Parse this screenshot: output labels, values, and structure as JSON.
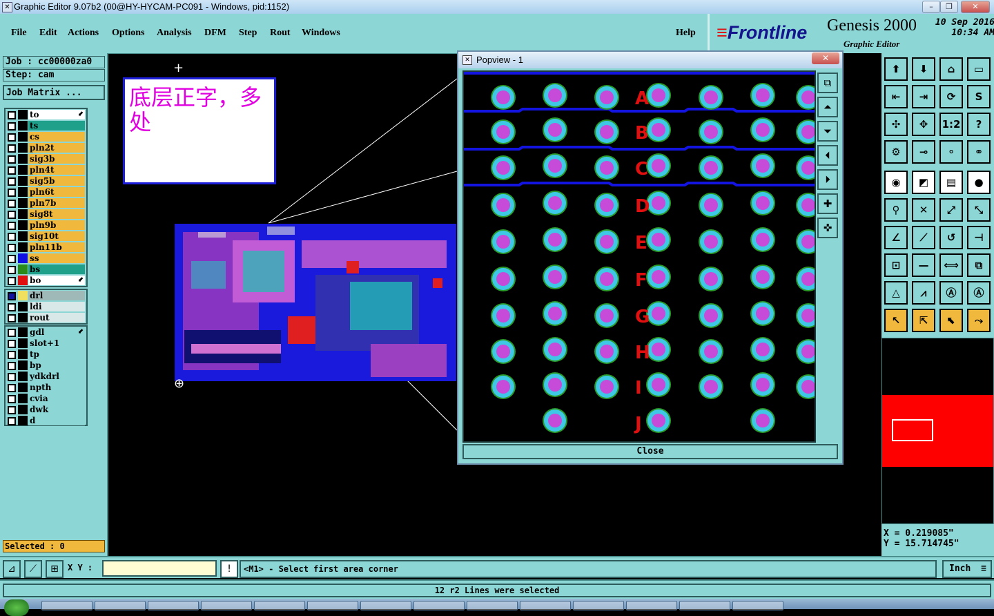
{
  "window": {
    "title": "Graphic Editor 9.07b2 (00@HY-HYCAM-PC091 - Windows, pid:1152)",
    "minimize": "–",
    "maximize": "❐",
    "close": "✕"
  },
  "menu": [
    "File",
    "Edit",
    "Actions",
    "Options",
    "Analysis",
    "DFM",
    "Step",
    "Rout",
    "Windows"
  ],
  "help": "Help",
  "brand": {
    "logo": "Frontline",
    "product": "Genesis 2000",
    "module": "Graphic Editor",
    "date": "10 Sep 2016",
    "time": "10:34 AM"
  },
  "job": {
    "job_label": "Job : cc00000za0",
    "step_label": "Step: cam",
    "matrix_button": "Job Matrix ..."
  },
  "layers_group1": [
    {
      "name": "to",
      "color": "#ffffff",
      "swatch": "#000000",
      "arrow": true
    },
    {
      "name": "ts",
      "color": "#1fa08a",
      "swatch": "#000000"
    },
    {
      "name": "cs",
      "color": "#f0b83c",
      "swatch": "#000000"
    },
    {
      "name": "pln2t",
      "color": "#f0b83c",
      "swatch": "#000000"
    },
    {
      "name": "sig3b",
      "color": "#f0b83c",
      "swatch": "#000000"
    },
    {
      "name": "pln4t",
      "color": "#f0b83c",
      "swatch": "#000000"
    },
    {
      "name": "sig5b",
      "color": "#f0b83c",
      "swatch": "#000000"
    },
    {
      "name": "pln6t",
      "color": "#f0b83c",
      "swatch": "#000000"
    },
    {
      "name": "pln7b",
      "color": "#f0b83c",
      "swatch": "#000000"
    },
    {
      "name": "sig8t",
      "color": "#f0b83c",
      "swatch": "#000000"
    },
    {
      "name": "pln9b",
      "color": "#f0b83c",
      "swatch": "#000000"
    },
    {
      "name": "sig10t",
      "color": "#f0b83c",
      "swatch": "#000000"
    },
    {
      "name": "pln11b",
      "color": "#f0b83c",
      "swatch": "#000000"
    },
    {
      "name": "ss",
      "color": "#f0b83c",
      "swatch": "#1010e0"
    },
    {
      "name": "bs",
      "color": "#1fa08a",
      "swatch": "#2a8a1a"
    },
    {
      "name": "bo",
      "color": "#ffffff",
      "swatch": "#e01010",
      "arrow": true
    }
  ],
  "layers_group2": [
    {
      "name": "drl",
      "color": "#9fb8b8",
      "swatch": "#f0e060",
      "sel": true
    },
    {
      "name": "ldi",
      "color": "#d8e8e8",
      "swatch": "#000000"
    },
    {
      "name": "rout",
      "color": "#d8e8e8",
      "swatch": "#000000"
    }
  ],
  "layers_group3": [
    {
      "name": "gdl",
      "color": "#8cd6d6",
      "swatch": "#000000",
      "arrow": true
    },
    {
      "name": "slot+1",
      "color": "#8cd6d6",
      "swatch": "#000000"
    },
    {
      "name": "tp",
      "color": "#8cd6d6",
      "swatch": "#000000"
    },
    {
      "name": "bp",
      "color": "#8cd6d6",
      "swatch": "#000000"
    },
    {
      "name": "ydkdrl",
      "color": "#8cd6d6",
      "swatch": "#000000"
    },
    {
      "name": "npth",
      "color": "#8cd6d6",
      "swatch": "#000000"
    },
    {
      "name": "cvia",
      "color": "#8cd6d6",
      "swatch": "#000000"
    },
    {
      "name": "dwk",
      "color": "#8cd6d6",
      "swatch": "#000000"
    },
    {
      "name": "d",
      "color": "#8cd6d6",
      "swatch": "#000000"
    }
  ],
  "selected": "Selected : 0",
  "note": "底层正字，多处",
  "popview": {
    "title": "Popview - 1",
    "close_button": "Close",
    "row_letters": [
      "A",
      "B",
      "C",
      "D",
      "E",
      "F",
      "G",
      "H",
      "I",
      "J"
    ]
  },
  "coords": {
    "x": "X = 0.219085\"",
    "y": "Y = 15.714745\""
  },
  "cmd": {
    "xy_label": "X Y :",
    "xy_value": "",
    "warn": "!",
    "prompt": "<M1> - Select first area corner",
    "unit": "Inch"
  },
  "status": "12 r2 Lines were selected",
  "colors": {
    "panel": "#8cd6d6",
    "layer_orange": "#f0b83c",
    "pad_fill": "#c64bd8",
    "pad_ring": "#3ec8e6",
    "trace": "#1414e0",
    "label_red": "#e01010"
  }
}
